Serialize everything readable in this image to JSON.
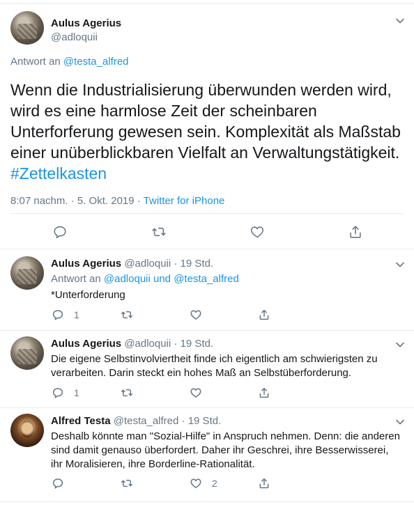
{
  "main_tweet": {
    "author_name": "Aulus Agerius",
    "author_handle": "@adloquii",
    "reply_label": "Antwort an",
    "reply_handle": "@testa_alfred",
    "text_main": "Wenn die Industrialisierung überwunden werden wird, wird es eine harmlose Zeit der scheinbaren Unterforferung gewesen sein. Komplexität als Maßstab einer unüberblickbaren  Vielfalt an Verwaltungstätigkeit. ",
    "hashtag": "#Zettelkasten",
    "timestamp": "8:07 nachm. · 5. Okt. 2019 · ",
    "source": "Twitter for iPhone"
  },
  "replies": [
    {
      "author_name": "Aulus Agerius",
      "author_handle": "@adloquii",
      "time": "· 19 Std.",
      "reply_label": "Antwort an",
      "reply_handle_1": "@adloquii",
      "reply_and": "und",
      "reply_handle_2": "@testa_alfred",
      "text": "*Unterforderung",
      "reply_count": "1",
      "retweet_count": "",
      "like_count": ""
    },
    {
      "author_name": "Aulus Agerius",
      "author_handle": "@adloquii",
      "time": "· 19 Std.",
      "text": "Die eigene Selbstinvolviertheit finde ich eigentlich am schwierigsten zu verarbeiten. Darin steckt ein hohes Maß an Selbstüberforderung.",
      "reply_count": "1",
      "retweet_count": "",
      "like_count": ""
    },
    {
      "author_name": "Alfred Testa",
      "author_handle": "@testa_alfred",
      "time": "· 19 Std.",
      "text": "Deshalb könnte man \"Sozial-Hilfe\" in Anspruch nehmen. Denn: die anderen sind damit genauso überfordert. Daher ihr Geschrei, ihre Besserwisserei, ihr Moralisieren, ihre Borderline-Rationalität.",
      "reply_count": "",
      "retweet_count": "",
      "like_count": "2"
    }
  ],
  "colors": {
    "text": "#14171a",
    "muted": "#657786",
    "link": "#1b95e0",
    "border": "#e6ecf0"
  },
  "icons": [
    "chevron-down-icon",
    "reply-icon",
    "retweet-icon",
    "like-icon",
    "share-icon"
  ]
}
